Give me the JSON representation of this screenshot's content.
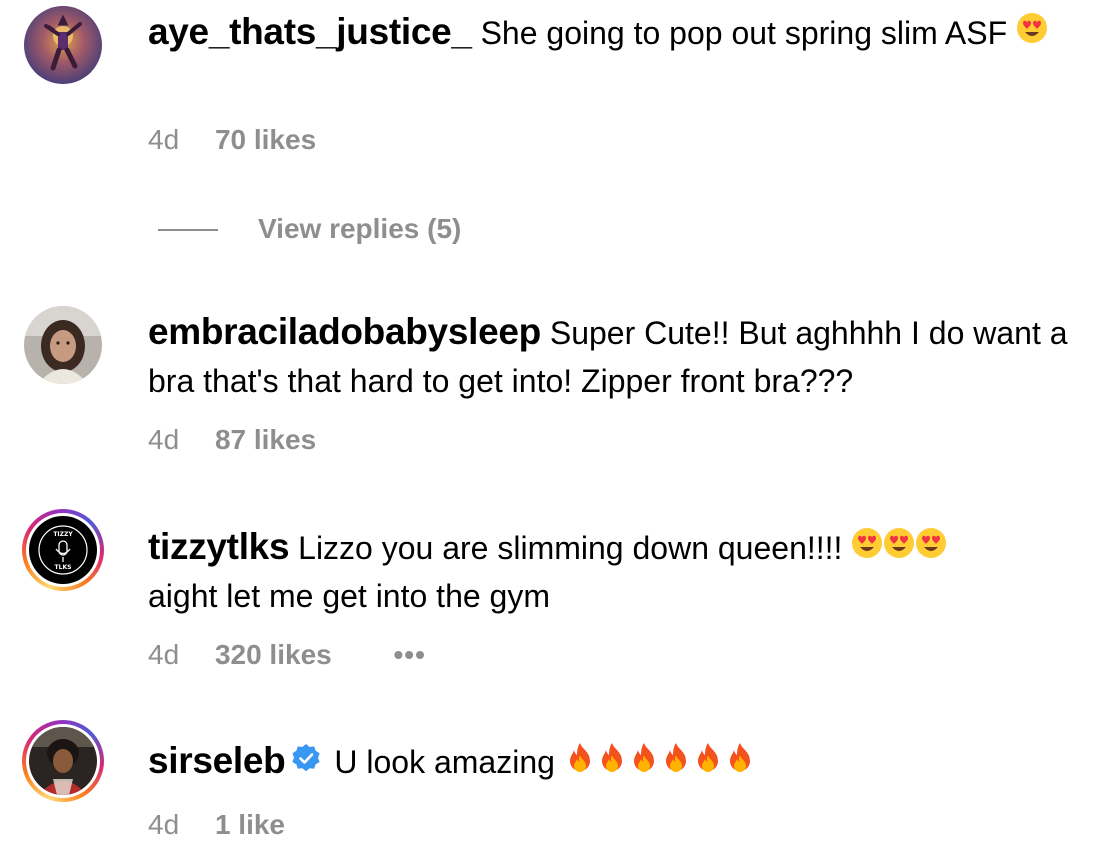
{
  "comments": [
    {
      "username": "aye_thats_justice_",
      "text": "She going to pop out spring slim ASF",
      "emoji": "heart-eyes",
      "time": "4d",
      "likes": "70 likes",
      "replies": "View replies (5)"
    },
    {
      "username": "embraciladobabysleep",
      "text": "Super Cute!! But aghhhh I do want a bra that's that hard to get into! Zipper front bra???",
      "time": "4d",
      "likes": "87 likes"
    },
    {
      "username": "tizzytlks",
      "text_a": "Lizzo you are slimming down queen!!!!",
      "text_b": "aight let me get into the gym",
      "time": "4d",
      "likes": "320 likes",
      "more": "•••"
    },
    {
      "username": "sirseleb",
      "verified": true,
      "text": "U look amazing",
      "time": "4d",
      "likes": "1 like"
    }
  ],
  "avatar_logo": {
    "top": "TIZZY",
    "bottom": "TLKS"
  },
  "colors": {
    "meta_gray": "#8e8e8e",
    "verified_blue": "#3897f0",
    "story_ring": "#d62976"
  }
}
